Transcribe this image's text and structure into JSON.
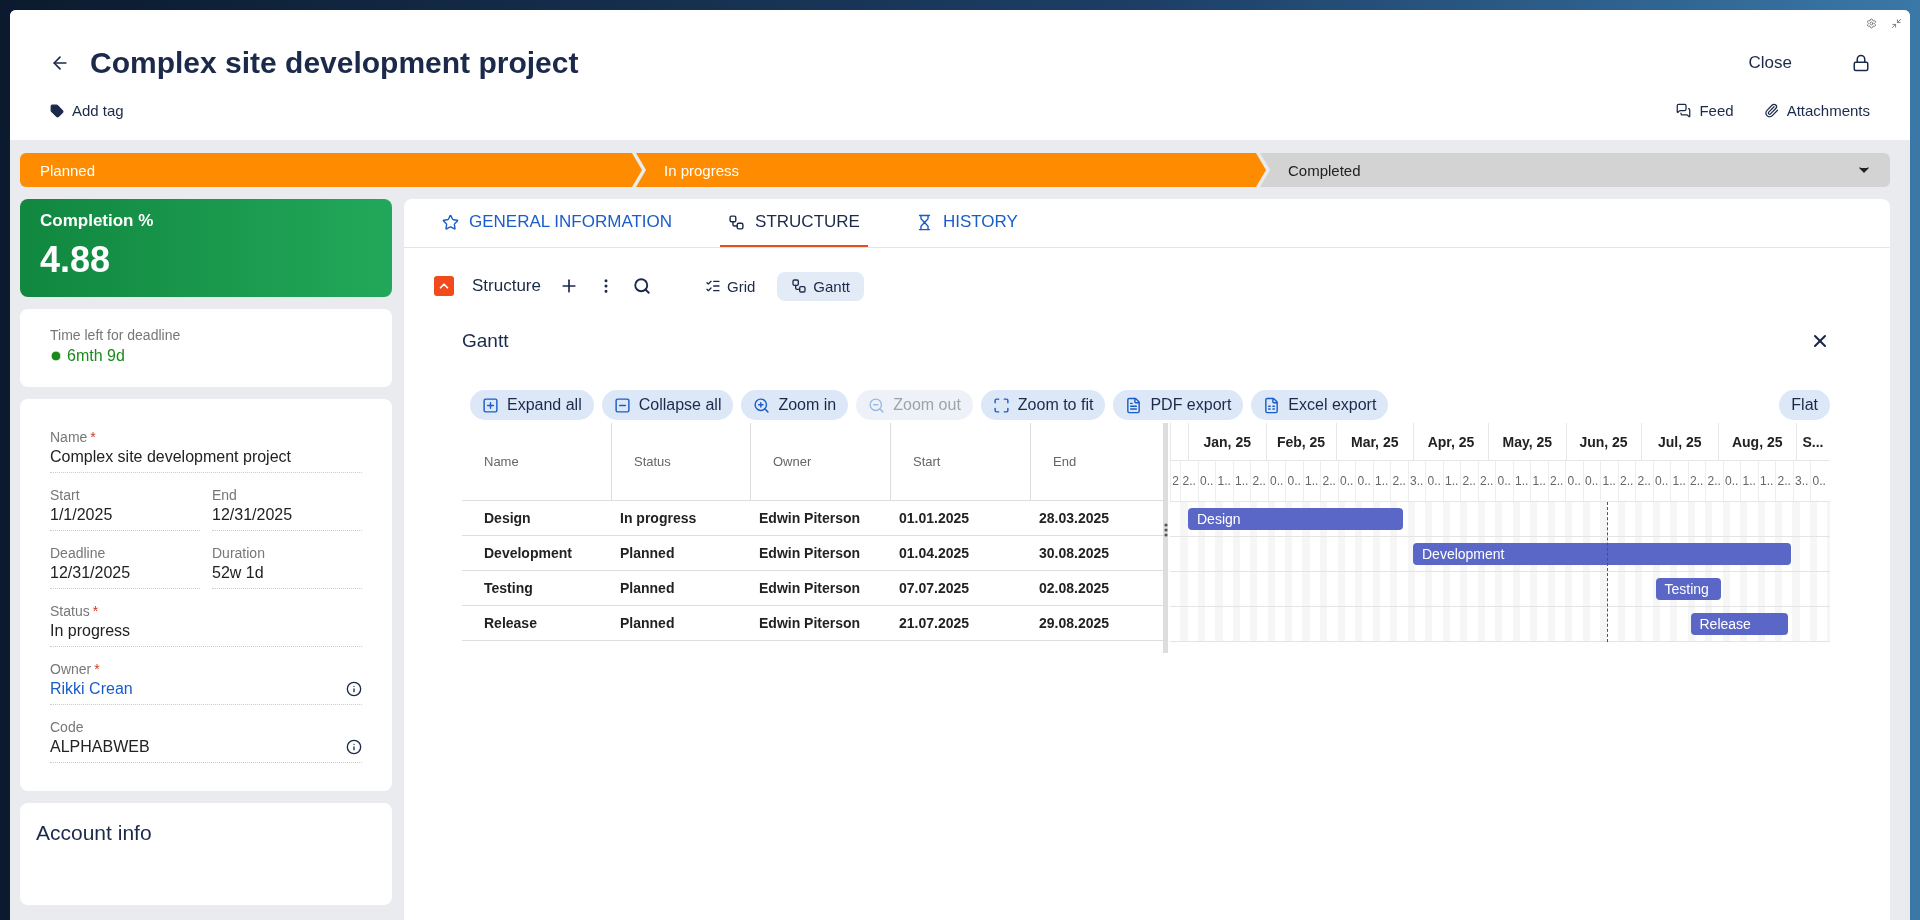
{
  "header": {
    "title": "Complex site development project",
    "add_tag": "Add tag",
    "close": "Close",
    "feed": "Feed",
    "attachments": "Attachments"
  },
  "stages": [
    {
      "label": "Planned",
      "reached": true
    },
    {
      "label": "In progress",
      "reached": true
    },
    {
      "label": "Completed",
      "reached": false
    }
  ],
  "completion": {
    "label": "Completion %",
    "value": "4.88"
  },
  "deadline": {
    "label": "Time left for deadline",
    "value": "6mth 9d"
  },
  "field_rows": [
    [
      {
        "label": "Name",
        "required_mark": "*",
        "value": "Complex site development project",
        "kind": "text",
        "info": false
      }
    ],
    [
      {
        "label": "Start",
        "value": "1/1/2025",
        "kind": "text",
        "info": false
      },
      {
        "label": "End",
        "value": "12/31/2025",
        "kind": "text",
        "info": false
      }
    ],
    [
      {
        "label": "Deadline",
        "value": "12/31/2025",
        "kind": "text",
        "info": false
      },
      {
        "label": "Duration",
        "value": "52w 1d",
        "kind": "text",
        "info": false
      }
    ],
    [
      {
        "label": "Status",
        "required_mark": "*",
        "value": "In progress",
        "kind": "text",
        "info": false
      }
    ],
    [
      {
        "label": "Owner",
        "required_mark": "*",
        "value": "Rikki Crean",
        "kind": "link",
        "info": true
      }
    ],
    [
      {
        "label": "Code",
        "value": "ALPHABWEB",
        "kind": "text",
        "info": true
      }
    ]
  ],
  "account_info": {
    "title": "Account info"
  },
  "tabs": [
    {
      "label": "GENERAL INFORMATION",
      "selected": false
    },
    {
      "label": "STRUCTURE",
      "selected": true
    },
    {
      "label": "HISTORY",
      "selected": false
    }
  ],
  "structure_toolbar": {
    "title": "Structure",
    "views": [
      {
        "label": "Grid",
        "selected": false
      },
      {
        "label": "Gantt",
        "selected": true
      }
    ]
  },
  "gantt": {
    "title": "Gantt",
    "mode": "Flat",
    "actions": [
      {
        "label": "Expand all",
        "disabled": false
      },
      {
        "label": "Collapse all",
        "disabled": false
      },
      {
        "label": "Zoom in",
        "disabled": false
      },
      {
        "label": "Zoom out",
        "disabled": true
      },
      {
        "label": "Zoom to fit",
        "disabled": false
      },
      {
        "label": "PDF export",
        "disabled": false
      },
      {
        "label": "Excel export",
        "disabled": false
      }
    ],
    "columns": [
      "Name",
      "Status",
      "Owner",
      "Start",
      "End"
    ],
    "rows": [
      {
        "name": "Design",
        "status": "In progress",
        "owner": "Edwin Piterson",
        "start": "01.01.2025",
        "end": "28.03.2025",
        "bar_label": "Design"
      },
      {
        "name": "Development",
        "status": "Planned",
        "owner": "Edwin Piterson",
        "start": "01.04.2025",
        "end": "30.08.2025",
        "bar_label": "Development"
      },
      {
        "name": "Testing",
        "status": "Planned",
        "owner": "Edwin Piterson",
        "start": "07.07.2025",
        "end": "02.08.2025",
        "bar_label": "Testing"
      },
      {
        "name": "Release",
        "status": "Planned",
        "owner": "Edwin Piterson",
        "start": "21.07.2025",
        "end": "29.08.2025",
        "bar_label": "Release"
      }
    ],
    "months": [
      "Jan, 25",
      "Feb, 25",
      "Mar, 25",
      "Apr, 25",
      "May, 25",
      "Jun, 25",
      "Jul, 25",
      "Aug, 25",
      "S..."
    ],
    "weeks": [
      "2",
      "2..",
      "0..",
      "1..",
      "1..",
      "2..",
      "0..",
      "0..",
      "1..",
      "2..",
      "0..",
      "0..",
      "1..",
      "2..",
      "3..",
      "0..",
      "1..",
      "2..",
      "2..",
      "0..",
      "1..",
      "1..",
      "2..",
      "0..",
      "0..",
      "1..",
      "2..",
      "2..",
      "0..",
      "1..",
      "2..",
      "2..",
      "0..",
      "1..",
      "1..",
      "2..",
      "3..",
      "0.."
    ]
  }
}
